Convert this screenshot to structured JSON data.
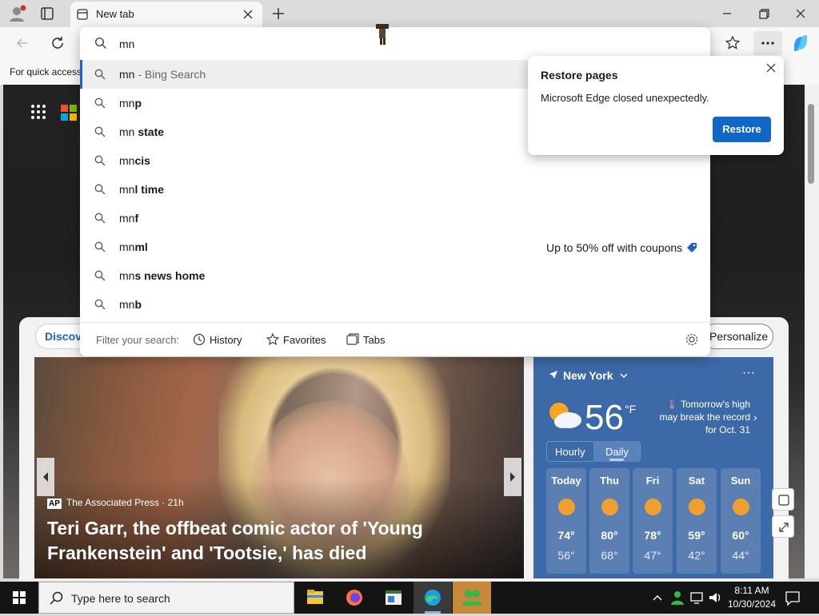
{
  "browser": {
    "tab_title": "New tab",
    "favorites_bar_text": "For quick access"
  },
  "omnibox": {
    "text": "mn",
    "suggestions": [
      {
        "prefix": "mn",
        "bold": "",
        "hint": " - Bing Search"
      },
      {
        "prefix": "mn",
        "bold": "p",
        "hint": ""
      },
      {
        "prefix": "mn",
        "bold": " state",
        "hint": ""
      },
      {
        "prefix": "mn",
        "bold": "cis",
        "hint": ""
      },
      {
        "prefix": "mn",
        "bold": "l time",
        "hint": ""
      },
      {
        "prefix": "mn",
        "bold": "f",
        "hint": ""
      },
      {
        "prefix": "mn",
        "bold": "ml",
        "hint": ""
      },
      {
        "prefix": "mn",
        "bold": "s news home",
        "hint": ""
      },
      {
        "prefix": "mn",
        "bold": "b",
        "hint": ""
      }
    ],
    "coupon_text": "Up to 50% off with coupons",
    "filter_label": "Filter your search:",
    "filters": [
      "History",
      "Favorites",
      "Tabs"
    ]
  },
  "restore_popup": {
    "title": "Restore pages",
    "message": "Microsoft Edge closed unexpectedly.",
    "button": "Restore"
  },
  "feed": {
    "discover_label": "Discov",
    "personalize_label": "Personalize",
    "hero": {
      "source_badge": "AP",
      "source": "The Associated Press · 21h",
      "headline": "Teri Garr, the offbeat comic actor of 'Young Frankenstein' and 'Tootsie,' has died"
    }
  },
  "weather": {
    "location": "New York",
    "temperature": "56",
    "unit": "°F",
    "alert": "Tomorrow's high may break the record for Oct. 31",
    "tab_hourly": "Hourly",
    "tab_daily": "Daily",
    "days": [
      {
        "name": "Today",
        "high": "74°",
        "low": "56°"
      },
      {
        "name": "Thu",
        "high": "80°",
        "low": "68°"
      },
      {
        "name": "Fri",
        "high": "78°",
        "low": "47°"
      },
      {
        "name": "Sat",
        "high": "59°",
        "low": "42°"
      },
      {
        "name": "Sun",
        "high": "60°",
        "low": "44°"
      }
    ]
  },
  "taskbar": {
    "search_placeholder": "Type here to search",
    "time": "8:11 AM",
    "date": "10/30/2024"
  },
  "colors": {
    "accent": "#1167c6",
    "weather_bg": "#3c6aa8"
  }
}
